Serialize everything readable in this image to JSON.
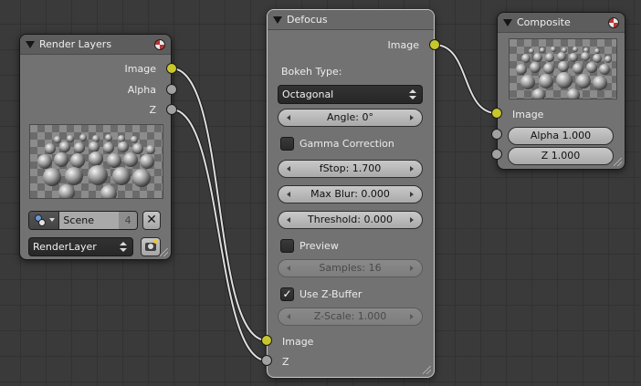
{
  "colors": {
    "socket_color": "#c7c729",
    "socket_value": "#a1a1a1",
    "link_color": "#dddddd"
  },
  "nodes": {
    "render_layers": {
      "title": "Render Layers",
      "outputs": [
        "Image",
        "Alpha",
        "Z"
      ],
      "scene": {
        "name": "Scene",
        "users": "4"
      },
      "layer_select": "RenderLayer",
      "icons": [
        "scene-datablock-icon",
        "close-icon",
        "render-icon",
        "preview-toggle-icon",
        "collapse-icon"
      ]
    },
    "defocus": {
      "title": "Defocus",
      "output_image": "Image",
      "bokeh_type_label": "Bokeh Type:",
      "bokeh_type_value": "Octagonal",
      "angle": "Angle: 0°",
      "gamma_correction": {
        "label": "Gamma Correction",
        "checked": false
      },
      "fstop": "fStop: 1.700",
      "max_blur": "Max Blur: 0.000",
      "threshold": "Threshold: 0.000",
      "preview": {
        "label": "Preview",
        "checked": false
      },
      "samples": "Samples: 16",
      "use_z_buffer": {
        "label": "Use Z-Buffer",
        "checked": true,
        "mark": "✓"
      },
      "z_scale": "Z-Scale: 1.000",
      "inputs": [
        "Image",
        "Z"
      ]
    },
    "composite": {
      "title": "Composite",
      "input_image": "Image",
      "alpha": "Alpha 1.000",
      "z": "Z 1.000"
    }
  }
}
